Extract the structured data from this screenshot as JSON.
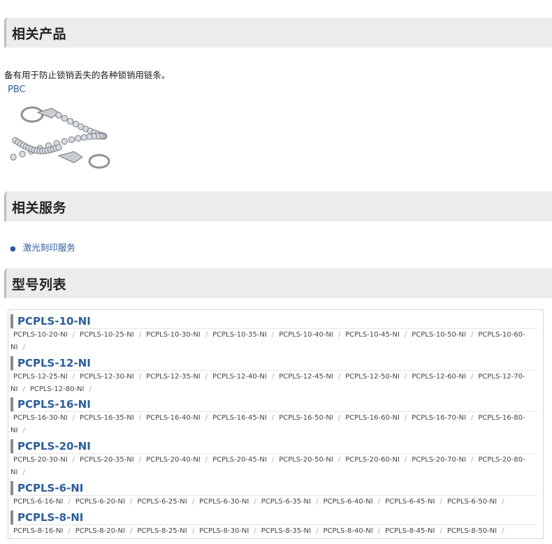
{
  "sections": {
    "related_products": "相关产品",
    "related_services": "相关服务",
    "model_list": "型号列表"
  },
  "description": "备有用于防止锁销丢失的各种锁销用链条。",
  "product": {
    "link_label": "PBC",
    "image": "ball-chain-with-rings"
  },
  "services": [
    {
      "label": "激光刻印服务"
    }
  ],
  "colors": {
    "link": "#2a5d9f",
    "section_bg": "#ececec",
    "accent_bar": "#8a8a8a"
  },
  "model_groups": [
    {
      "title": "PCPLS-10-NI",
      "line1": [
        "PCPLS-10-20-NI",
        "PCPLS-10-25-NI",
        "PCPLS-10-30-NI",
        "PCPLS-10-35-NI",
        "PCPLS-10-40-NI",
        "PCPLS-10-45-NI",
        "PCPLS-10-50-NI",
        "PCPLS-10-60-"
      ],
      "line2": [
        "NI"
      ]
    },
    {
      "title": "PCPLS-12-NI",
      "line1": [
        "PCPLS-12-25-NI",
        "PCPLS-12-30-NI",
        "PCPLS-12-35-NI",
        "PCPLS-12-40-NI",
        "PCPLS-12-45-NI",
        "PCPLS-12-50-NI",
        "PCPLS-12-60-NI",
        "PCPLS-12-70-"
      ],
      "line2": [
        "NI",
        "PCPLS-12-80-NI"
      ]
    },
    {
      "title": "PCPLS-16-NI",
      "line1": [
        "PCPLS-16-30-NI",
        "PCPLS-16-35-NI",
        "PCPLS-16-40-NI",
        "PCPLS-16-45-NI",
        "PCPLS-16-50-NI",
        "PCPLS-16-60-NI",
        "PCPLS-16-70-NI",
        "PCPLS-16-80-"
      ],
      "line2": [
        "NI"
      ]
    },
    {
      "title": "PCPLS-20-NI",
      "line1": [
        "PCPLS-20-30-NI",
        "PCPLS-20-35-NI",
        "PCPLS-20-40-NI",
        "PCPLS-20-45-NI",
        "PCPLS-20-50-NI",
        "PCPLS-20-60-NI",
        "PCPLS-20-70-NI",
        "PCPLS-20-80-"
      ],
      "line2": [
        "NI"
      ]
    },
    {
      "title": "PCPLS-6-NI",
      "line1": [
        "PCPLS-6-16-NI",
        "PCPLS-6-20-NI",
        "PCPLS-6-25-NI",
        "PCPLS-6-30-NI",
        "PCPLS-6-35-NI",
        "PCPLS-6-40-NI",
        "PCPLS-6-45-NI",
        "PCPLS-6-50-NI"
      ],
      "line2": []
    },
    {
      "title": "PCPLS-8-NI",
      "line1": [
        "PCPLS-8-16-NI",
        "PCPLS-8-20-NI",
        "PCPLS-8-25-NI",
        "PCPLS-8-30-NI",
        "PCPLS-8-35-NI",
        "PCPLS-8-40-NI",
        "PCPLS-8-45-NI",
        "PCPLS-8-50-NI"
      ],
      "line2": []
    }
  ]
}
